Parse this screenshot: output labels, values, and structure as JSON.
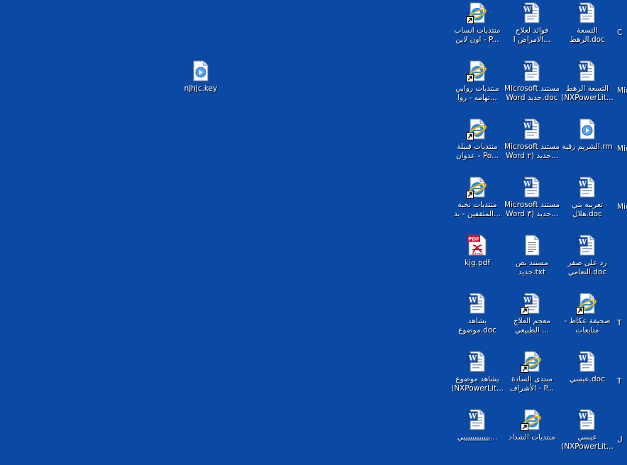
{
  "desktop": {
    "background_color": "#0a4aa4",
    "loose_icon": {
      "label": "njhjc.key",
      "type": "media"
    },
    "column1": [
      {
        "label": "التسعة الرهط.doc",
        "type": "word",
        "shortcut": false
      },
      {
        "label": "التسعة الرهط (NXPowerLit...",
        "type": "word",
        "shortcut": false
      },
      {
        "label": "الشريم رقية.rm",
        "type": "media",
        "shortcut": false
      },
      {
        "label": "تغريبة بني هلال.doc",
        "type": "word",
        "shortcut": false
      },
      {
        "label": "رد على صقر التعامي.doc",
        "type": "word",
        "shortcut": false
      },
      {
        "label": "صحيفة عكاظ - متابعات",
        "type": "ie",
        "shortcut": true
      },
      {
        "label": "عبسي.doc",
        "type": "word",
        "shortcut": false
      },
      {
        "label": "عبسي (NXPowerLit...",
        "type": "word",
        "shortcut": false
      }
    ],
    "column2": [
      {
        "label": "فوائد لعلاج الامراض ا...",
        "type": "word",
        "shortcut": false
      },
      {
        "label": "Microsoft مستند Word جديد.doc",
        "type": "word",
        "shortcut": false
      },
      {
        "label": "Microsoft مستند Word جديد (٢...",
        "type": "word",
        "shortcut": false
      },
      {
        "label": "Microsoft مستند Word جديد (٣...",
        "type": "word",
        "shortcut": false
      },
      {
        "label": "مستند نص جديد.txt",
        "type": "text",
        "shortcut": false
      },
      {
        "label": "معجم العلاج الطبيعي ...",
        "type": "word",
        "shortcut": true
      },
      {
        "label": "منتدى السادة الأشراف - P...",
        "type": "ie",
        "shortcut": true
      },
      {
        "label": "منتديات الشداد",
        "type": "ie",
        "shortcut": true
      }
    ],
    "column3": [
      {
        "label": "منتديات انساب اون لاين - P...",
        "type": "ie",
        "shortcut": true
      },
      {
        "label": "منتديات روابي تهامه - روا...",
        "type": "ie",
        "shortcut": true
      },
      {
        "label": "منتديات قبيلة عدوان - Po...",
        "type": "ie",
        "shortcut": true
      },
      {
        "label": "منتديات نخبة المثقفين - بد...",
        "type": "ie",
        "shortcut": true
      },
      {
        "label": "kjg.pdf",
        "type": "pdf",
        "shortcut": false
      },
      {
        "label": "يشاهد موضوع.doc",
        "type": "word",
        "shortcut": false
      },
      {
        "label": "يشاهد موضوع (NXPowerLit...",
        "type": "word",
        "shortcut": false
      },
      {
        "label": "ييييييييييييي...",
        "type": "word",
        "shortcut": false
      }
    ],
    "partial_column": [
      {
        "label": "C"
      },
      {
        "label": "Mic Fro"
      },
      {
        "label": "Mic Pu"
      },
      {
        "label": "Mic V"
      },
      {
        "label": ""
      },
      {
        "label": "T"
      },
      {
        "label": "T"
      },
      {
        "label": "ل"
      }
    ]
  }
}
